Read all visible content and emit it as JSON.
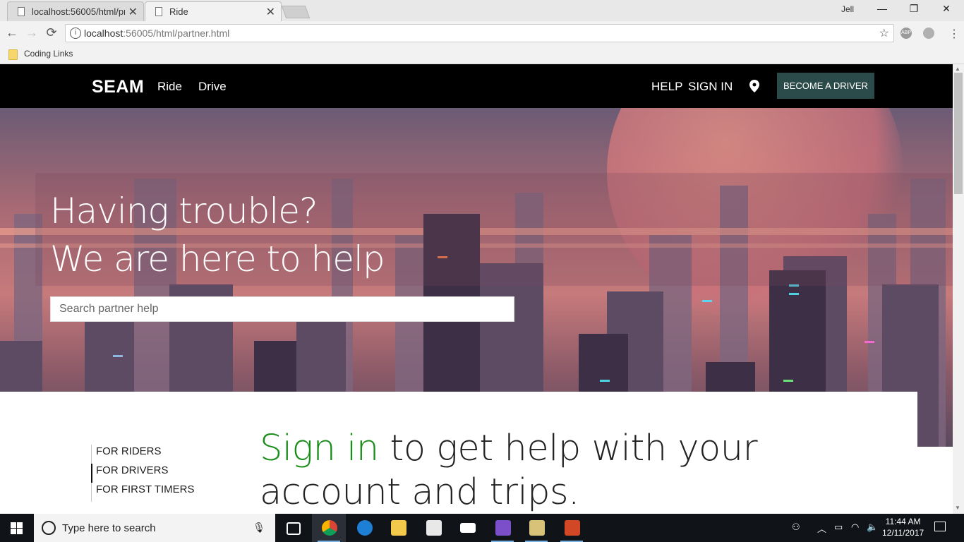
{
  "browser": {
    "tabs": [
      {
        "label": "localhost:56005/html/pro",
        "active": false
      },
      {
        "label": "Ride",
        "active": true
      }
    ],
    "window_controls": {
      "minimize": "—",
      "maximize": "❐",
      "close": "✕"
    },
    "nav": {
      "back": "←",
      "forward": "→",
      "reload": "⟳"
    },
    "address": {
      "host": "localhost",
      "rest": ":56005/html/partner.html"
    },
    "extensions": [
      "ABP",
      ""
    ],
    "bookmarks": [
      {
        "label": "Coding Links"
      }
    ]
  },
  "site": {
    "logo": "SEAM",
    "nav_left": [
      "Ride",
      "Drive"
    ],
    "nav_right": [
      "HELP",
      "SIGN IN"
    ],
    "cta": "BECOME A DRIVER",
    "hero": {
      "line1": "Having trouble?",
      "line2": "We are here to help",
      "search_placeholder": "Search partner help"
    },
    "side_nav": [
      {
        "label": "FOR RIDERS",
        "active": false
      },
      {
        "label": "FOR DRIVERS",
        "active": true
      },
      {
        "label": "FOR FIRST TIMERS",
        "active": false
      }
    ],
    "headline": {
      "accent": "Sign in",
      "rest_line1": " to get help with your",
      "line2": "account and trips."
    },
    "colors": {
      "accent_green": "#1a8c1a",
      "cta_bg": "#2a4b49",
      "nav_bg": "#000000"
    }
  },
  "taskbar": {
    "search_placeholder": "Type here to search",
    "apps": [
      "task-view-icon",
      "chrome-icon",
      "edge-icon",
      "file-explorer-icon",
      "store-icon",
      "mail-icon",
      "visual-studio-icon",
      "app-icon",
      "powerpoint-icon"
    ],
    "clock": {
      "time": "11:44 AM",
      "date": "12/11/2017"
    }
  }
}
